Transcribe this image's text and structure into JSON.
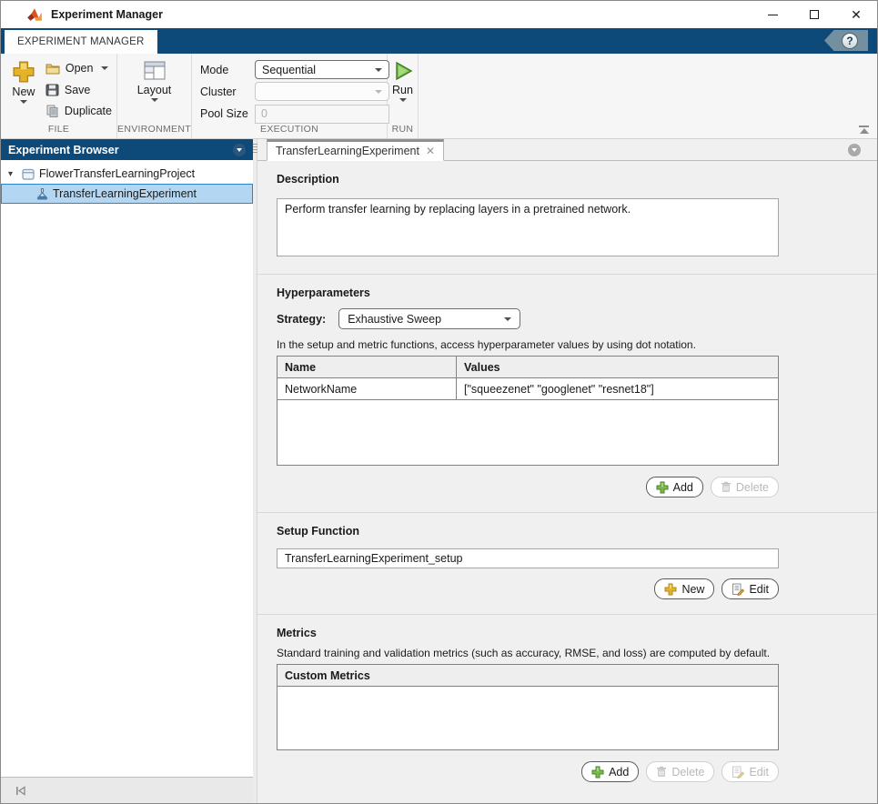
{
  "window": {
    "title": "Experiment Manager"
  },
  "ribbon": {
    "tab_label": "EXPERIMENT MANAGER",
    "file": {
      "label": "FILE",
      "new_label": "New",
      "open_label": "Open",
      "save_label": "Save",
      "duplicate_label": "Duplicate"
    },
    "environment": {
      "label": "ENVIRONMENT",
      "layout_label": "Layout"
    },
    "execution": {
      "label": "EXECUTION",
      "mode_label": "Mode",
      "mode_value": "Sequential",
      "cluster_label": "Cluster",
      "pool_size_label": "Pool Size",
      "pool_size_value": "0"
    },
    "run": {
      "label": "RUN",
      "run_label": "Run"
    }
  },
  "browser": {
    "title": "Experiment Browser",
    "project_label": "FlowerTransferLearningProject",
    "experiment_label": "TransferLearningExperiment"
  },
  "main": {
    "tab_label": "TransferLearningExperiment",
    "description": {
      "heading": "Description",
      "text": "Perform transfer learning by replacing layers in a pretrained network."
    },
    "hyperparameters": {
      "heading": "Hyperparameters",
      "strategy_label": "Strategy:",
      "strategy_value": "Exhaustive Sweep",
      "note": "In the setup and metric functions, access hyperparameter values by using dot notation.",
      "table": {
        "headers": [
          "Name",
          "Values"
        ],
        "rows": [
          [
            "NetworkName",
            "[\"squeezenet\" \"googlenet\" \"resnet18\"]"
          ]
        ]
      },
      "add_label": "Add",
      "delete_label": "Delete"
    },
    "setup_function": {
      "heading": "Setup Function",
      "value": "TransferLearningExperiment_setup",
      "new_label": "New",
      "edit_label": "Edit"
    },
    "metrics": {
      "heading": "Metrics",
      "note": "Standard training and validation metrics (such as accuracy, RMSE, and loss) are computed by default.",
      "custom_header": "Custom Metrics",
      "add_label": "Add",
      "delete_label": "Delete",
      "edit_label": "Edit"
    }
  },
  "colors": {
    "ribbon_blue": "#0d4a7a",
    "selection_blue": "#b3d7f2",
    "run_green": "#6fb643",
    "add_green": "#76b043",
    "new_gold": "#deac1f"
  }
}
